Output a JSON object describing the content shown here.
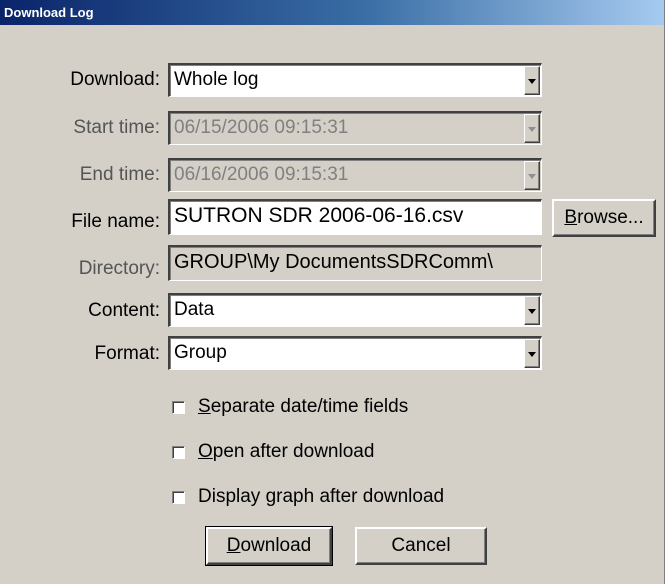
{
  "window": {
    "title": "Download Log"
  },
  "form": {
    "download": {
      "label": "Download:",
      "value": "Whole log"
    },
    "start_time": {
      "label": "Start time:",
      "value": "06/15/2006 09:15:31"
    },
    "end_time": {
      "label": "End time:",
      "value": "06/16/2006 09:15:31"
    },
    "file_name": {
      "label": "File name:",
      "value": "SUTRON SDR 2006-06-16.csv"
    },
    "browse_button": {
      "accel": "B",
      "rest": "rowse..."
    },
    "directory": {
      "label": "Directory:",
      "value": "GROUP\\My DocumentsSDRComm\\"
    },
    "content": {
      "label": "Content:",
      "value": "Data"
    },
    "format": {
      "label": "Format:",
      "value": "Group"
    }
  },
  "options": {
    "separate_datetime": {
      "accel": "S",
      "rest": "eparate date/time fields",
      "checked": false
    },
    "open_after": {
      "accel": "O",
      "rest": "pen after download",
      "checked": false
    },
    "display_graph": {
      "before": "Display ",
      "accel": "g",
      "rest": "raph after download",
      "checked": false
    }
  },
  "buttons": {
    "download": {
      "accel": "D",
      "rest": "ownload"
    },
    "cancel": {
      "label": "Cancel"
    }
  }
}
